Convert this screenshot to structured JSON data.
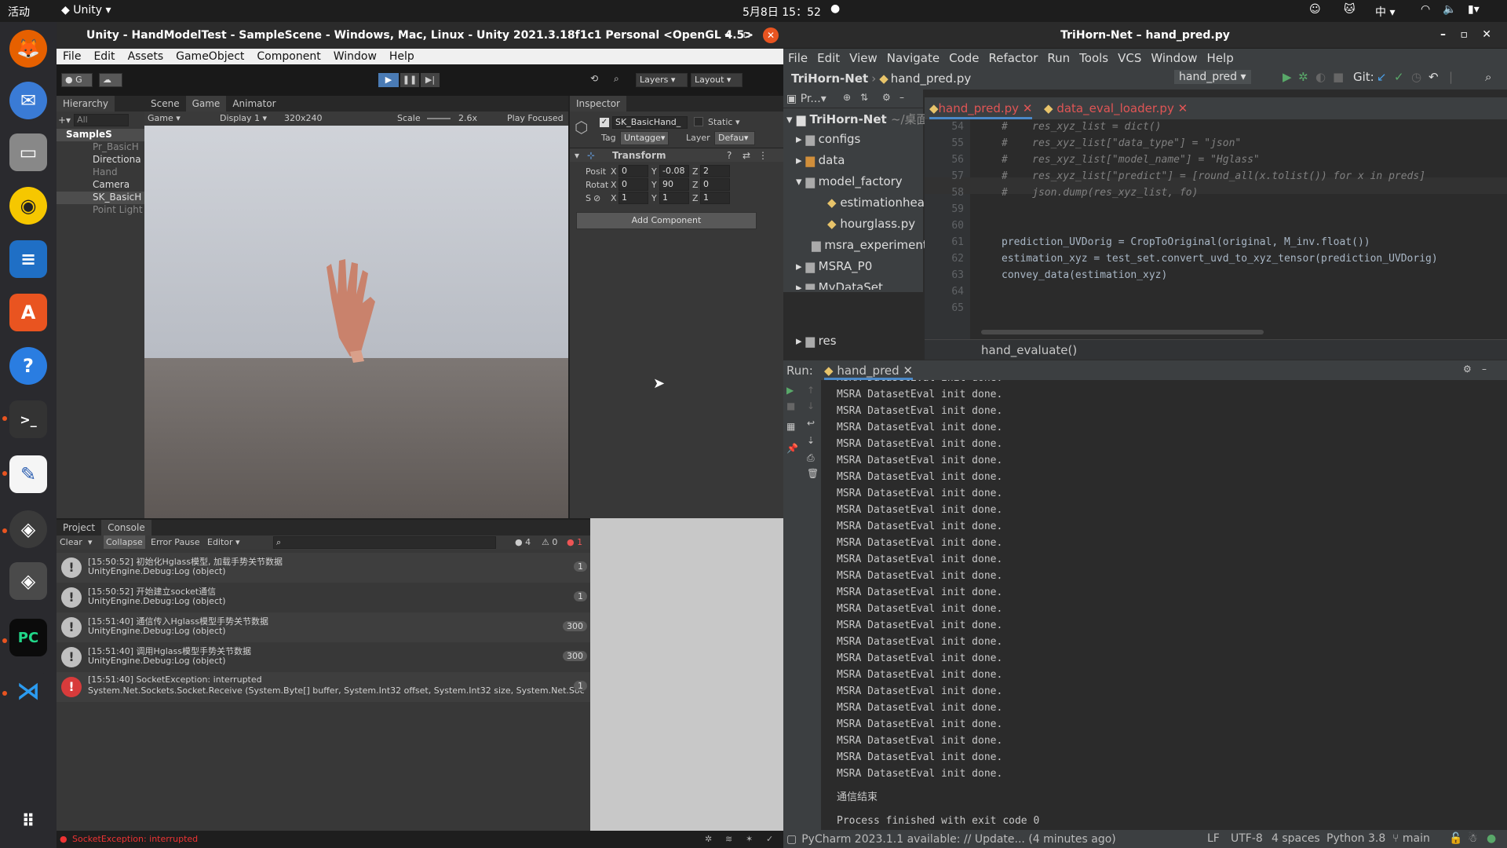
{
  "topbar": {
    "activities": "活动",
    "app_menu": "Unity",
    "clock": "5月8日 15：52",
    "input_method": "中"
  },
  "unity": {
    "title": "Unity - HandModelTest - SampleScene - Windows, Mac, Linux - Unity 2021.3.18f1c1 Personal <OpenGL 4.5>",
    "menu": [
      "File",
      "Edit",
      "Assets",
      "GameObject",
      "Component",
      "Window",
      "Help"
    ],
    "toolbar": {
      "account": "G",
      "layers": "Layers",
      "layout": "Layout"
    },
    "hierarchy": {
      "tab": "Hierarchy",
      "search_placeholder": "All",
      "items": [
        "SampleS",
        "Pr_BasicH",
        "Directiona",
        "Hand",
        "Camera",
        "SK_BasicH",
        "Point Light"
      ]
    },
    "scene_tabs": [
      "Scene",
      "Game",
      "Animator"
    ],
    "game_bar": {
      "mode": "Game",
      "display": "Display 1",
      "resolution": "320x240",
      "scale_label": "Scale",
      "scale_value": "2.6x",
      "play_focused": "Play Focused"
    },
    "inspector": {
      "tab": "Inspector",
      "object_name": "SK_BasicHand_",
      "static": "Static",
      "tag_label": "Tag",
      "tag_value": "Untagge",
      "layer_label": "Layer",
      "layer_value": "Defau",
      "transform": "Transform",
      "rows": [
        {
          "label": "Posit",
          "x": "0",
          "y": "-0.08",
          "z": "2"
        },
        {
          "label": "Rotat",
          "x": "0",
          "y": "90",
          "z": "0"
        },
        {
          "label": "S",
          "x": "1",
          "y": "1",
          "z": "1"
        }
      ],
      "add_component": "Add Component"
    },
    "bottom_tabs": [
      "Project",
      "Console"
    ],
    "console_toolbar": {
      "clear": "Clear",
      "collapse": "Collapse",
      "error_pause": "Error Pause",
      "editor": "Editor",
      "info_count": "4",
      "warn_count": "0",
      "error_count": "1"
    },
    "console": [
      {
        "line1": "[15:50:52] 初始化Hglass模型, 加载手势关节数据",
        "line2": "UnityEngine.Debug:Log (object)",
        "count": "1",
        "type": "info"
      },
      {
        "line1": "[15:50:52] 开始建立socket通信",
        "line2": "UnityEngine.Debug:Log (object)",
        "count": "1",
        "type": "info"
      },
      {
        "line1": "[15:51:40] 通信传入Hglass模型手势关节数据",
        "line2": "UnityEngine.Debug:Log (object)",
        "count": "300",
        "type": "info"
      },
      {
        "line1": "[15:51:40] 调用Hglass模型手势关节数据",
        "line2": "UnityEngine.Debug:Log (object)",
        "count": "300",
        "type": "info"
      },
      {
        "line1": "[15:51:40] SocketException: interrupted",
        "line2": "System.Net.Sockets.Socket.Receive (System.Byte[] buffer, System.Int32 offset, System.Int32 size, System.Net.Soc",
        "count": "1",
        "type": "error"
      }
    ],
    "status_error": "SocketException: interrupted"
  },
  "pycharm": {
    "title": "TriHorn-Net – hand_pred.py",
    "menu": [
      "File",
      "Edit",
      "View",
      "Navigate",
      "Code",
      "Refactor",
      "Run",
      "Tools",
      "VCS",
      "Window",
      "Help"
    ],
    "breadcrumb_project": "TriHorn-Net",
    "breadcrumb_file": "hand_pred.py",
    "run_config": "hand_pred",
    "git_label": "Git:",
    "project_label": "Pr...",
    "tree": [
      {
        "name": "TriHorn-Net",
        "suffix": "~/桌面",
        "type": "root"
      },
      {
        "name": "configs",
        "type": "folder"
      },
      {
        "name": "data",
        "type": "folder-orange"
      },
      {
        "name": "model_factory",
        "type": "folder-open"
      },
      {
        "name": "estimationheac",
        "type": "file"
      },
      {
        "name": "hourglass.py",
        "type": "file"
      },
      {
        "name": "msra_experiment",
        "type": "folder-plain"
      },
      {
        "name": "MSRA_P0",
        "type": "folder"
      },
      {
        "name": "MyDataSet",
        "type": "folder"
      },
      {
        "name": "res",
        "type": "folder"
      }
    ],
    "editor_tabs": [
      "hand_pred.py",
      "data_eval_loader.py"
    ],
    "code": [
      {
        "n": "54",
        "text": "#    res_xyz_list = dict()",
        "cmt": true
      },
      {
        "n": "55",
        "text": "#    res_xyz_list[\"data_type\"] = \"json\"",
        "cmt": true
      },
      {
        "n": "56",
        "text": "#    res_xyz_list[\"model_name\"] = \"Hglass\"",
        "cmt": true
      },
      {
        "n": "57",
        "text": "#    res_xyz_list[\"predict\"] = [round_all(x.tolist()) for x in preds]",
        "cmt": true
      },
      {
        "n": "58",
        "text": "#    json.dump(res_xyz_list, fo)",
        "cmt": true
      },
      {
        "n": "59",
        "text": "",
        "cmt": false
      },
      {
        "n": "60",
        "text": "",
        "cmt": false
      },
      {
        "n": "61",
        "text": "prediction_UVDorig = CropToOriginal(original, M_inv.float())",
        "cmt": false
      },
      {
        "n": "62",
        "text": "estimation_xyz = test_set.convert_uvd_to_xyz_tensor(prediction_UVDorig)",
        "cmt": false
      },
      {
        "n": "63",
        "text": "convey_data(estimation_xyz)",
        "cmt": false
      },
      {
        "n": "64",
        "text": "",
        "cmt": false
      },
      {
        "n": "65",
        "text": "",
        "cmt": false
      }
    ],
    "breadcrumb_function": "hand_evaluate()",
    "run_label": "Run:",
    "run_tab": "hand_pred",
    "console_repeat": "MSRA DatasetEval init done.",
    "console_tail": "通信结束",
    "console_exit": "Process finished with exit code 0",
    "status": {
      "message": "PyCharm 2023.1.1 available: // Update... (4 minutes ago)",
      "lf": "LF",
      "enc": "UTF-8",
      "indent": "4 spaces",
      "python": "Python 3.8",
      "branch": "main"
    }
  }
}
